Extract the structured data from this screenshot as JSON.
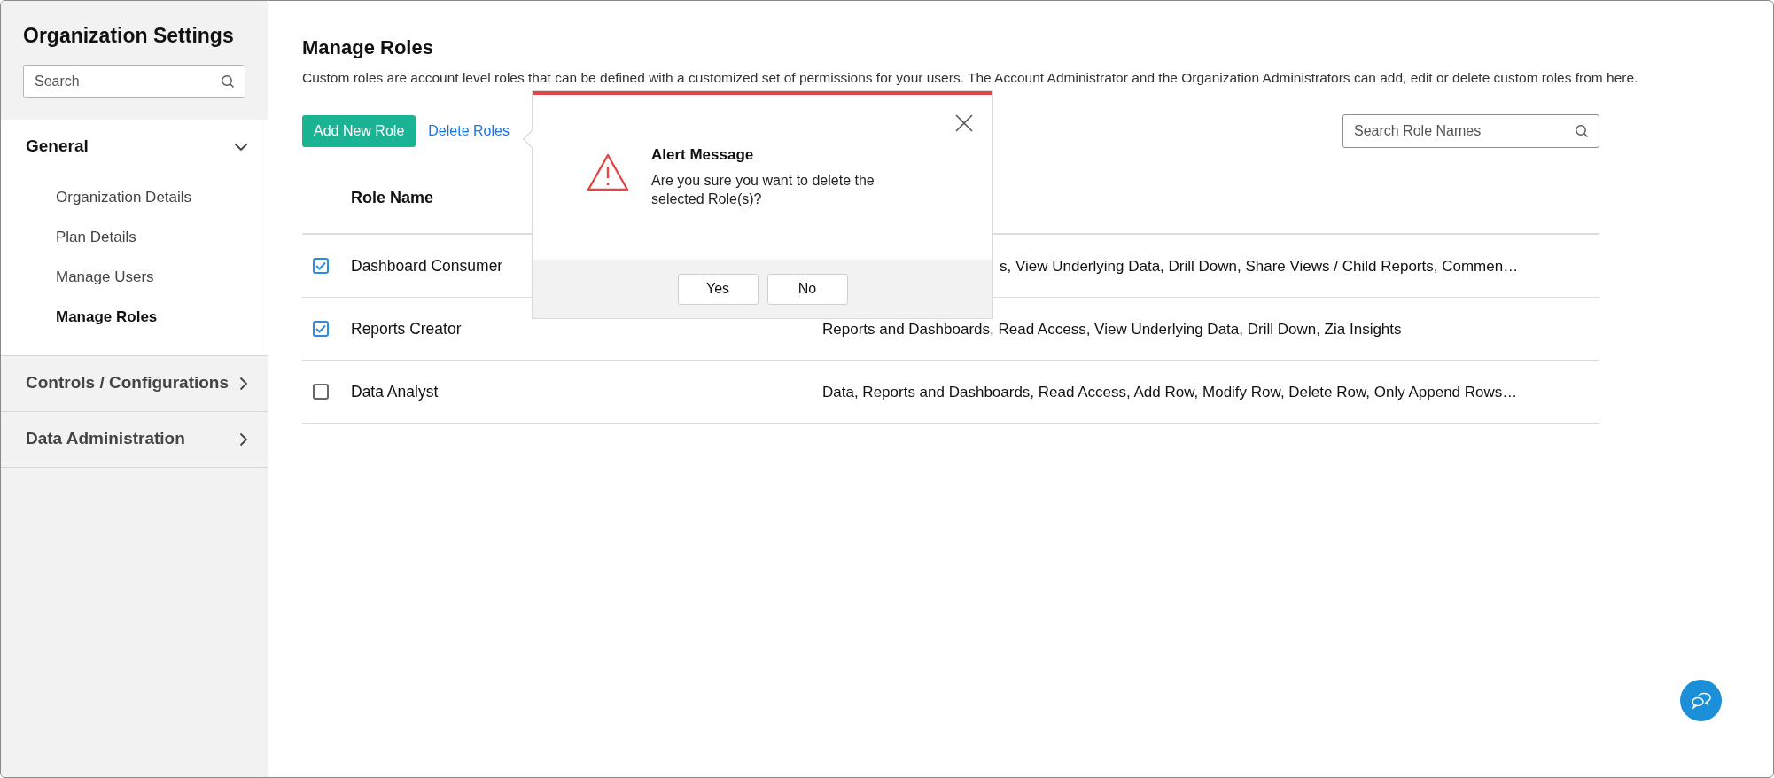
{
  "sidebar": {
    "title": "Organization Settings",
    "search": {
      "placeholder": "Search"
    },
    "sections": [
      {
        "label": "General",
        "expanded": true,
        "items": [
          {
            "label": "Organization Details",
            "selected": false
          },
          {
            "label": "Plan Details",
            "selected": false
          },
          {
            "label": "Manage Users",
            "selected": false
          },
          {
            "label": "Manage Roles",
            "selected": true
          }
        ]
      },
      {
        "label": "Controls / Configurations",
        "expanded": false
      },
      {
        "label": "Data Administration",
        "expanded": false
      }
    ]
  },
  "page": {
    "title": "Manage Roles",
    "description": "Custom roles are account level roles that can be defined with a customized set of permissions for your users. The Account Administrator and the Organization Administrators can add, edit or delete custom roles from here.",
    "add_button": "Add New Role",
    "delete_link": "Delete Roles",
    "search": {
      "placeholder": "Search Role Names"
    }
  },
  "table": {
    "columns": [
      "Role Name"
    ],
    "rows": [
      {
        "checked": true,
        "name": "Dashboard Consumer",
        "permissions": "s, View Underlying Data, Drill Down, Share Views / Child Reports, Commen…"
      },
      {
        "checked": true,
        "name": "Reports Creator",
        "permissions": "Reports and Dashboards, Read Access, View Underlying Data, Drill Down, Zia Insights"
      },
      {
        "checked": false,
        "name": "Data Analyst",
        "permissions": "Data, Reports and Dashboards, Read Access, Add Row, Modify Row, Delete Row, Only Append Rows…"
      }
    ]
  },
  "dialog": {
    "title": "Alert Message",
    "message": "Are you sure you want to delete the selected Role(s)?",
    "buttons": [
      "Yes",
      "No"
    ]
  }
}
